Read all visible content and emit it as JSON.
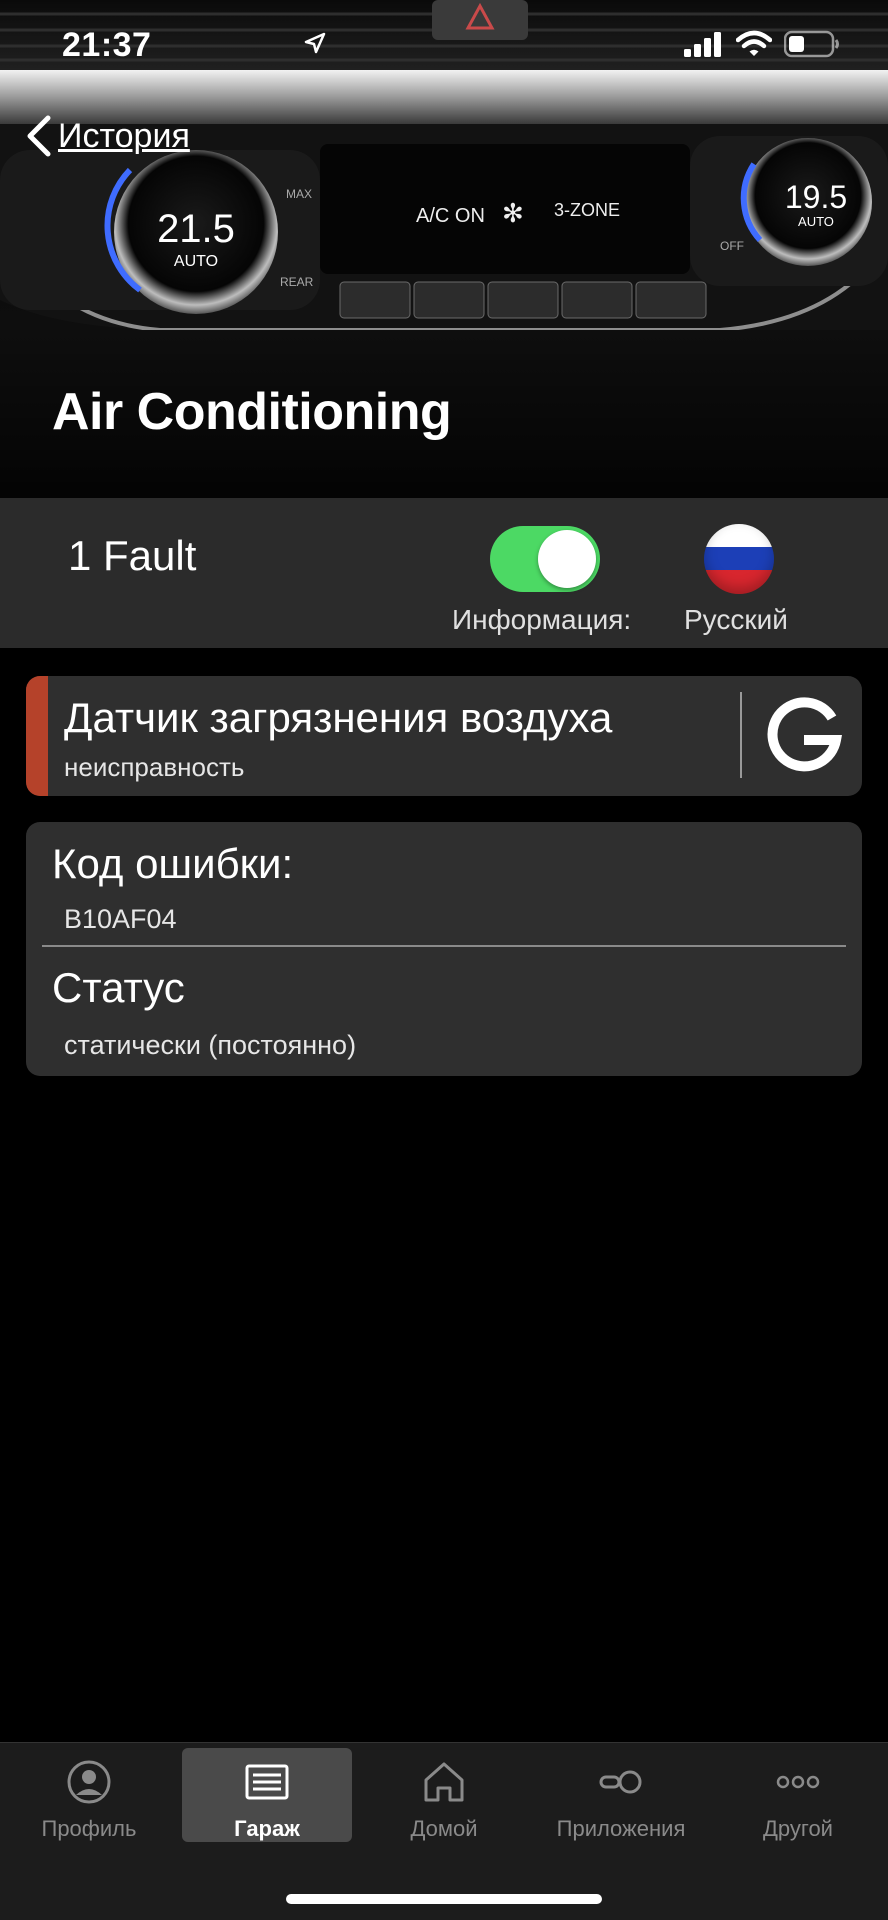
{
  "status_bar": {
    "time": "21:37"
  },
  "nav": {
    "back_label": "История"
  },
  "hero": {
    "title": "Air Conditioning",
    "panel": {
      "left_temp": "21.5",
      "left_mode": "AUTO",
      "right_temp": "19.5",
      "right_mode": "AUTO",
      "ac_label": "A/C ON",
      "zone_label": "3-ZONE",
      "max_label": "MAX",
      "rear_label": "REAR",
      "off_label": "OFF"
    }
  },
  "fault_bar": {
    "count_label": "1 Fault",
    "info_label": "Информация:",
    "info_toggle_on": true,
    "language_label": "Русский"
  },
  "fault": {
    "name": "Датчик загрязнения воздуха",
    "subtitle": "неисправность",
    "accent_color": "#b5422a",
    "action_icon": "google-g-icon"
  },
  "details": {
    "code_title": "Код ошибки:",
    "code_value": "B10AF04",
    "status_title": "Статус",
    "status_value": "статически (постоянно)"
  },
  "tabs": [
    {
      "label": "Профиль",
      "icon": "profile-icon",
      "active": false
    },
    {
      "label": "Гараж",
      "icon": "garage-icon",
      "active": true
    },
    {
      "label": "Домой",
      "icon": "home-icon",
      "active": false
    },
    {
      "label": "Приложения",
      "icon": "apps-icon",
      "active": false
    },
    {
      "label": "Другой",
      "icon": "more-icon",
      "active": false
    }
  ],
  "colors": {
    "toggle_on": "#4cd964",
    "fault_accent": "#b5422a",
    "card_bg": "#2f2f2f",
    "bar_bg": "#2b2b2b"
  }
}
